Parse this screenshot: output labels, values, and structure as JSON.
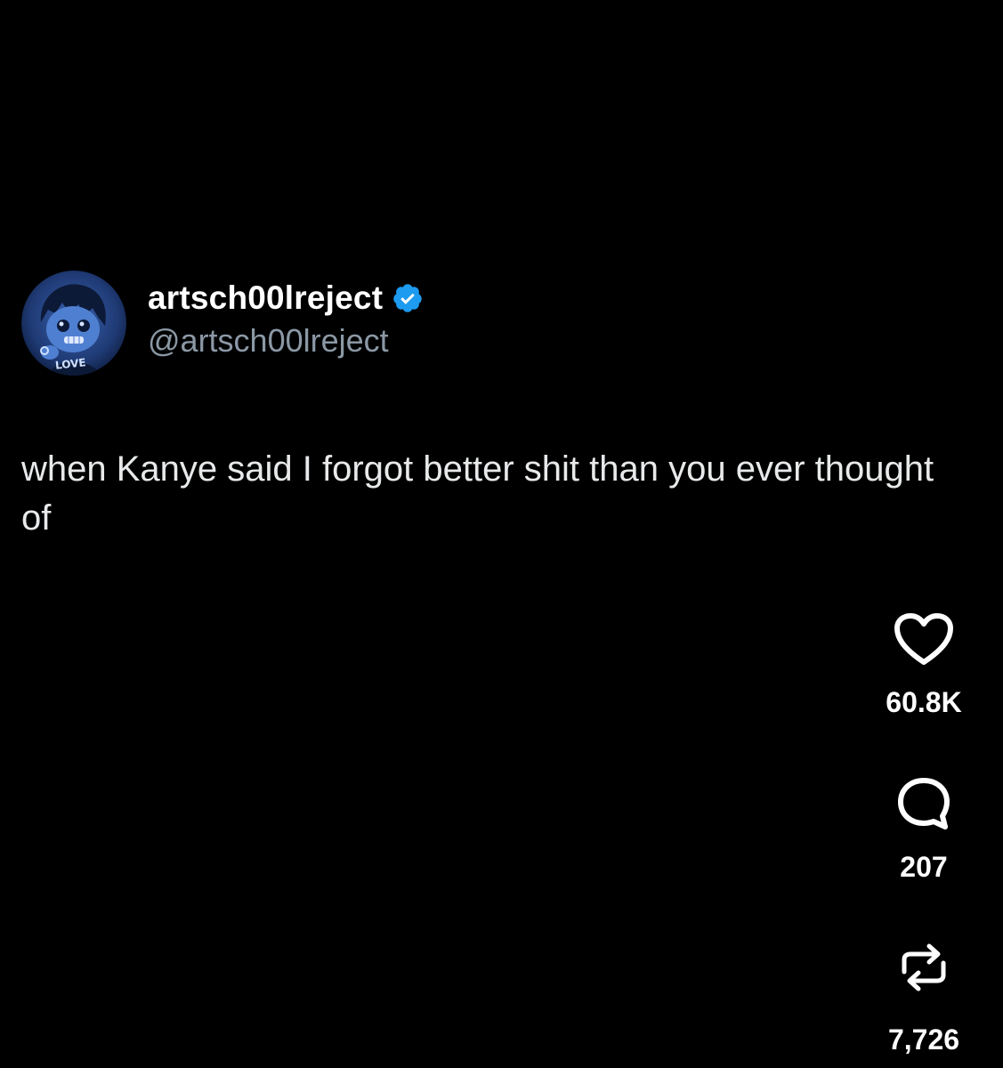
{
  "post": {
    "author": {
      "display_name": "artsch00lreject",
      "handle": "@artsch00lreject",
      "verified": true,
      "avatar_label": "LOVE"
    },
    "text": "when Kanye said I forgot better shit than you ever thought of"
  },
  "actions": {
    "like": {
      "icon": "heart-icon",
      "count": "60.8K"
    },
    "reply": {
      "icon": "reply-icon",
      "count": "207"
    },
    "repost": {
      "icon": "repost-icon",
      "count": "7,726"
    }
  },
  "colors": {
    "background": "#000000",
    "verified_blue": "#1d9bf0",
    "handle_gray": "#8b98a5",
    "avatar_blue": "#2a4d8f"
  }
}
